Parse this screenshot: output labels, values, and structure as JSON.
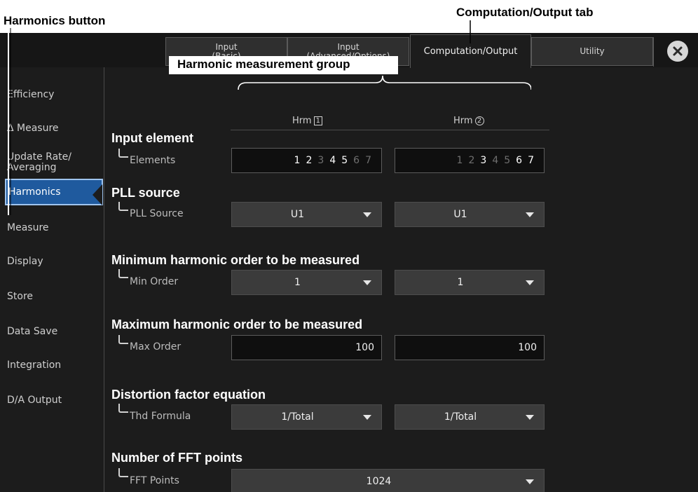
{
  "callouts": {
    "harmonics_button": "Harmonics button",
    "computation_tab": "Computation/Output tab",
    "harmonic_group": "Harmonic measurement group"
  },
  "tabs": [
    {
      "line1": "Input",
      "line2": "(Basic)"
    },
    {
      "line1": "Input",
      "line2": "(Advanced/Options)"
    },
    {
      "line1": "Computation/Output",
      "line2": ""
    },
    {
      "line1": "Utility",
      "line2": ""
    }
  ],
  "close_icon": "close-x-icon",
  "sidebar": {
    "items": [
      {
        "line1": "Efficiency",
        "line2": ""
      },
      {
        "line1": "Δ Measure",
        "line2": ""
      },
      {
        "line1": "Update Rate/",
        "line2": "Averaging"
      },
      {
        "line1": "Harmonics",
        "line2": ""
      },
      {
        "line1": "Measure",
        "line2": ""
      },
      {
        "line1": "Display",
        "line2": ""
      },
      {
        "line1": "Store",
        "line2": ""
      },
      {
        "line1": "Data Save",
        "line2": ""
      },
      {
        "line1": "Integration",
        "line2": ""
      },
      {
        "line1": "D/A Output",
        "line2": ""
      }
    ],
    "active_index": 3
  },
  "columns": {
    "hrm1": {
      "label": "Hrm",
      "marker": "1"
    },
    "hrm2": {
      "label": "Hrm",
      "marker": "2"
    }
  },
  "sections": {
    "input_element": {
      "title": "Input element",
      "label": "Elements",
      "hrm1": [
        {
          "n": "1",
          "on": true
        },
        {
          "n": "2",
          "on": true
        },
        {
          "n": "3",
          "on": false
        },
        {
          "n": "4",
          "on": true
        },
        {
          "n": "5",
          "on": true
        },
        {
          "n": "6",
          "on": false
        },
        {
          "n": "7",
          "on": false
        }
      ],
      "hrm2": [
        {
          "n": "1",
          "on": false
        },
        {
          "n": "2",
          "on": false
        },
        {
          "n": "3",
          "on": true
        },
        {
          "n": "4",
          "on": false
        },
        {
          "n": "5",
          "on": false
        },
        {
          "n": "6",
          "on": true
        },
        {
          "n": "7",
          "on": true
        }
      ]
    },
    "pll_source": {
      "title": "PLL source",
      "label": "PLL Source",
      "hrm1": "U1",
      "hrm2": "U1"
    },
    "min_order": {
      "title": "Minimum harmonic order to be measured",
      "label": "Min Order",
      "hrm1": "1",
      "hrm2": "1"
    },
    "max_order": {
      "title": "Maximum harmonic order to be measured",
      "label": "Max Order",
      "hrm1": "100",
      "hrm2": "100"
    },
    "thd_formula": {
      "title": "Distortion factor equation",
      "label": "Thd Formula",
      "hrm1": "1/Total",
      "hrm2": "1/Total"
    },
    "fft_points": {
      "title": "Number of FFT points",
      "label": "FFT Points",
      "value": "1024"
    }
  },
  "colors": {
    "active_sidebar": "#1f5a9e",
    "active_sidebar_border": "#9fc4ef",
    "screen_bg": "#1c1c1c",
    "dropdown_bg": "#3b3b3b",
    "field_bg": "#0f0f0f"
  }
}
